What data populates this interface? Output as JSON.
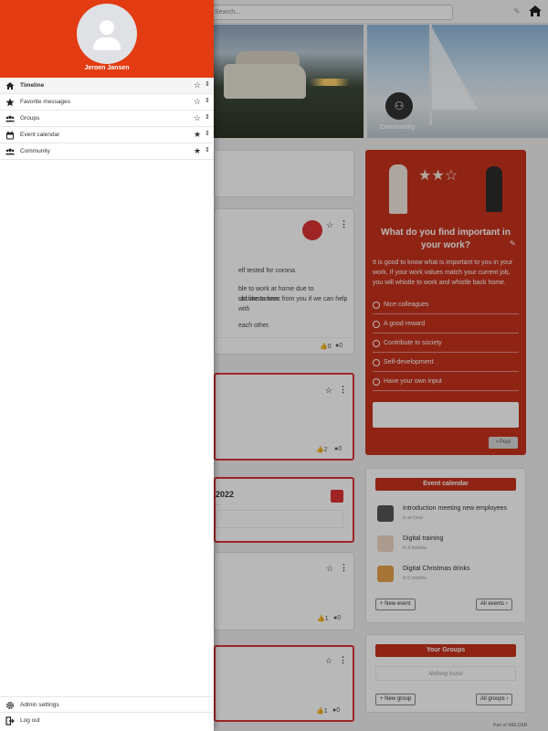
{
  "search": {
    "placeholder": "Search..."
  },
  "community_label": "Community",
  "drawer": {
    "user_name": "Jeroen Jansen",
    "nav": [
      {
        "label": "Timeline",
        "icon": "home-icon",
        "starred": false
      },
      {
        "label": "Favorite messages",
        "icon": "star-icon",
        "starred": false
      },
      {
        "label": "Groups",
        "icon": "users-icon",
        "starred": false
      },
      {
        "label": "Event calendar",
        "icon": "calendar-icon",
        "starred": true
      },
      {
        "label": "Community",
        "icon": "users-icon",
        "starred": true
      }
    ],
    "bottom": [
      {
        "label": "Admin settings",
        "icon": "gear-icon"
      },
      {
        "label": "Log out",
        "icon": "logout-icon"
      }
    ]
  },
  "posts": {
    "post1": {
      "lines": [
        "elf tested for corona.",
        "ble to work at home due to circumstances.",
        "uld like to hear from you if we can help with",
        "each other."
      ],
      "likes": "0",
      "comments": "0"
    },
    "post2": {
      "likes": "2",
      "comments": "0"
    },
    "post3": {
      "title": "2022",
      "sub": "..."
    },
    "post4": {
      "likes": "1",
      "comments": "0"
    },
    "post5": {
      "likes": "1",
      "comments": "0"
    }
  },
  "question_widget": {
    "title": "What do you find important in your work?",
    "description": "It is good to know what is important to you in your work. If your work values match your current job, you will whistle to work and whistle back home.",
    "options": [
      "Nice colleagues",
      "A good reward",
      "Contribute to society",
      "Self-development",
      "Have your own input"
    ],
    "post_label": "Post"
  },
  "event_calendar": {
    "title": "Event calendar",
    "events": [
      {
        "title": "Introduction meeting new employees",
        "when": "in an hour"
      },
      {
        "title": "Digital training",
        "when": "in 4 months"
      },
      {
        "title": "Digital Christmas drinks",
        "when": "in 6 months"
      }
    ],
    "new_label": "New event",
    "all_label": "All events"
  },
  "your_groups": {
    "title": "Your Groups",
    "empty": "Nothing found",
    "new_label": "New group",
    "all_label": "All groups"
  },
  "footer": "Part of WELDER",
  "colors": {
    "drawer_header": "#e33b12",
    "widget_red": "#c8321c"
  }
}
